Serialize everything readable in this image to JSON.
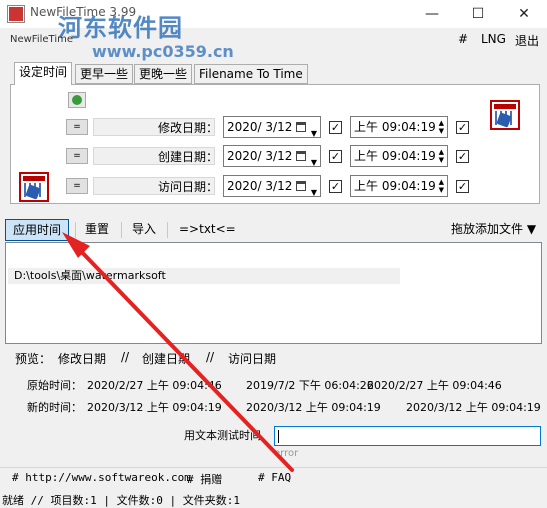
{
  "window": {
    "title": "NewFileTime 3.99",
    "subtitle": "NewFileTime",
    "minimize": "—",
    "maximize": "☐",
    "close": "✕"
  },
  "watermark": {
    "main": "河东软件园",
    "url": "www.pc0359.cn"
  },
  "menu": {
    "hash": "#",
    "lng": "LNG",
    "exit": "退出"
  },
  "tabs": [
    {
      "label": "设定时间",
      "active": true
    },
    {
      "label": "更早一些",
      "active": false
    },
    {
      "label": "更晚一些",
      "active": false
    },
    {
      "label": "Filename To Time",
      "active": false
    }
  ],
  "rows": [
    {
      "btn": "=",
      "label": "修改日期：",
      "date": "2020/ 3/12",
      "time": "上午 09:04:19",
      "date_checked": true,
      "time_checked": true
    },
    {
      "btn": "=",
      "label": "创建日期：",
      "date": "2020/ 3/12",
      "time": "上午 09:04:19",
      "date_checked": true,
      "time_checked": true
    },
    {
      "btn": "=",
      "label": "访问日期：",
      "date": "2020/ 3/12",
      "time": "上午 09:04:19",
      "date_checked": true,
      "time_checked": true
    }
  ],
  "toolbar": {
    "apply": "应用时间",
    "reset": "重置",
    "import": "导入",
    "txt": "=>txt<=",
    "drag_add": "拖放添加文件 ▼"
  },
  "file_list": [
    "D:\\tools\\桌面\\watermarksoft"
  ],
  "preview": {
    "label": "预览：",
    "modify": "修改日期",
    "sep1": "//",
    "create": "创建日期",
    "sep2": "//",
    "access": "访问日期"
  },
  "original": {
    "label": "原始时间：",
    "modify": "2020/2/27 上午 09:04:46",
    "create": "2019/7/2 下午 06:04:26",
    "access": "2020/2/27 上午 09:04:46"
  },
  "new": {
    "label": "新的时间：",
    "modify": "2020/3/12 上午 09:04:19",
    "create": "2020/3/12 上午 09:04:19",
    "access": "2020/3/12 上午 09:04:19"
  },
  "test": {
    "label": "用文本测试时间",
    "value": "",
    "error": "error"
  },
  "links": {
    "website": "# http://www.softwareok.com",
    "donate": "# 捐赠",
    "faq": "# FAQ"
  },
  "status": {
    "text": "就绪 // 项目数:1  | 文件数:0   | 文件夹数:1"
  }
}
